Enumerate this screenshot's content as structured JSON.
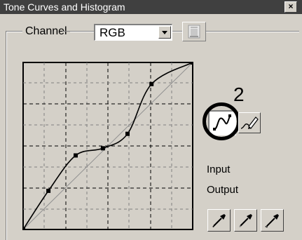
{
  "window": {
    "title": "Tone Curves and Histogram",
    "close_glyph": "×"
  },
  "channel": {
    "label": "Channel",
    "selected": "RGB",
    "options": [
      "RGB"
    ]
  },
  "graph": {
    "input_label": "Input",
    "output_label": "Output",
    "curve_points": [
      {
        "input": 0,
        "output": 0
      },
      {
        "input": 38,
        "output": 59
      },
      {
        "input": 79,
        "output": 113
      },
      {
        "input": 120,
        "output": 124
      },
      {
        "input": 157,
        "output": 146
      },
      {
        "input": 193,
        "output": 222
      },
      {
        "input": 255,
        "output": 255
      }
    ]
  },
  "annotation": {
    "callout_number": "2"
  },
  "icons": {
    "close": "close-icon",
    "dropdown": "chevron-down-icon",
    "channel_image": "image-icon",
    "curve_tool": "curve-tool-icon",
    "pencil_tool": "pencil-icon",
    "black_eyedropper": "eyedropper-icon",
    "gray_eyedropper": "eyedropper-icon",
    "white_eyedropper": "eyedropper-icon"
  },
  "colors": {
    "dialog": "#d4d0c8",
    "titlebar": "#404040",
    "curve": "#000000",
    "diagonal": "#909090"
  }
}
